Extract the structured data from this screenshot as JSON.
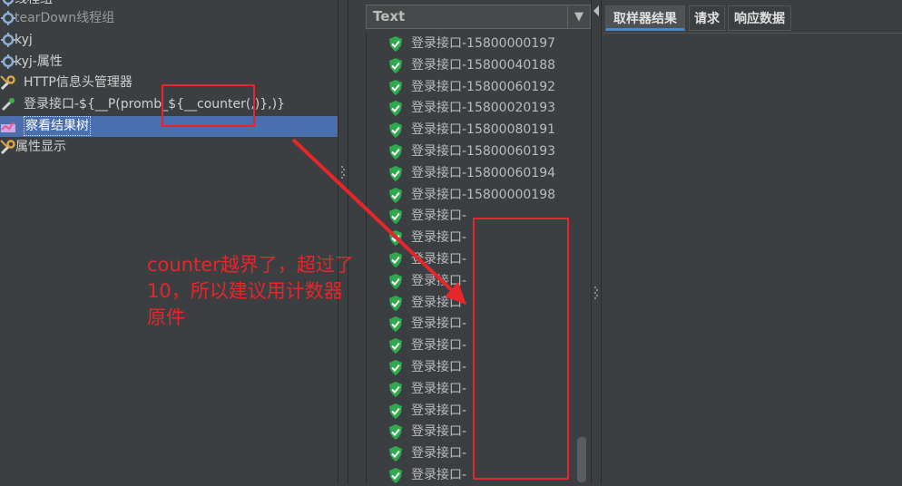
{
  "tree": {
    "items": [
      {
        "label": "线程组",
        "icon": "gear-icon"
      },
      {
        "label": "tearDown线程组",
        "icon": "gear-icon"
      },
      {
        "label": "kyj",
        "icon": "gear-icon"
      },
      {
        "label": "kyj-属性",
        "icon": "gear-icon"
      },
      {
        "label": "HTTP信息头管理器",
        "icon": "wrench-icon"
      },
      {
        "label": "登录接口-${__P(promb_${__counter(,)},)}",
        "icon": "pipette-icon"
      },
      {
        "label": "察看结果树",
        "icon": "chart-icon",
        "selected": true
      },
      {
        "label": "属性显示",
        "icon": "wrench-icon"
      }
    ]
  },
  "renderer": {
    "selected": "Text"
  },
  "results": [
    "登录接口-15800000197",
    "登录接口-15800040188",
    "登录接口-15800060192",
    "登录接口-15800020193",
    "登录接口-15800080191",
    "登录接口-15800060193",
    "登录接口-15800060194",
    "登录接口-15800000198",
    "登录接口-",
    "登录接口-",
    "登录接口-",
    "登录接口-",
    "登录接口-",
    "登录接口-",
    "登录接口-",
    "登录接口-",
    "登录接口-",
    "登录接口-",
    "登录接口-",
    "登录接口-",
    "登录接口-"
  ],
  "tabs": [
    {
      "label": "取样器结果",
      "active": true
    },
    {
      "label": "请求",
      "active": false
    },
    {
      "label": "响应数据",
      "active": false
    }
  ],
  "annotation": {
    "line1": "counter越界了，超过了",
    "line2": "10，所以建议用计数器",
    "line3": "原件"
  },
  "colors": {
    "accent": "#4b6eaf",
    "annotation": "#e5262a",
    "success": "#2fa84f"
  }
}
